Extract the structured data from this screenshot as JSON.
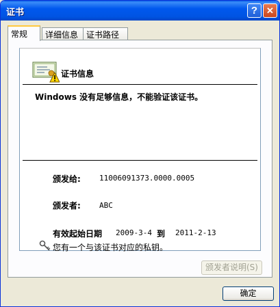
{
  "window": {
    "title": "证书"
  },
  "tabs": [
    {
      "label": "常规",
      "active": true
    },
    {
      "label": "详细信息",
      "active": false
    },
    {
      "label": "证书路径",
      "active": false
    }
  ],
  "cert": {
    "header": "证书信息",
    "warning": "Windows 没有足够信息，不能验证该证书。",
    "issued_to_label": "颁发给:",
    "issued_to_value": "11006091373.0000.0005",
    "issued_by_label": "颁发者:",
    "issued_by_value": "ABC",
    "valid_label": "有效起始日期",
    "valid_from": "2009-3-4",
    "valid_to_label": "到",
    "valid_to": "2011-2-13",
    "private_key_note": "您有一个与该证书对应的私钥。"
  },
  "buttons": {
    "issuer_statement": "颁发者说明(S)",
    "ok": "确定"
  },
  "icons": {
    "help": "help-icon",
    "close": "close-icon",
    "certificate": "certificate-warning-icon",
    "key": "key-icon"
  },
  "colors": {
    "titlebar": "#0054e3",
    "window_bg": "#ece9d8",
    "tab_highlight": "#ffc83c"
  }
}
